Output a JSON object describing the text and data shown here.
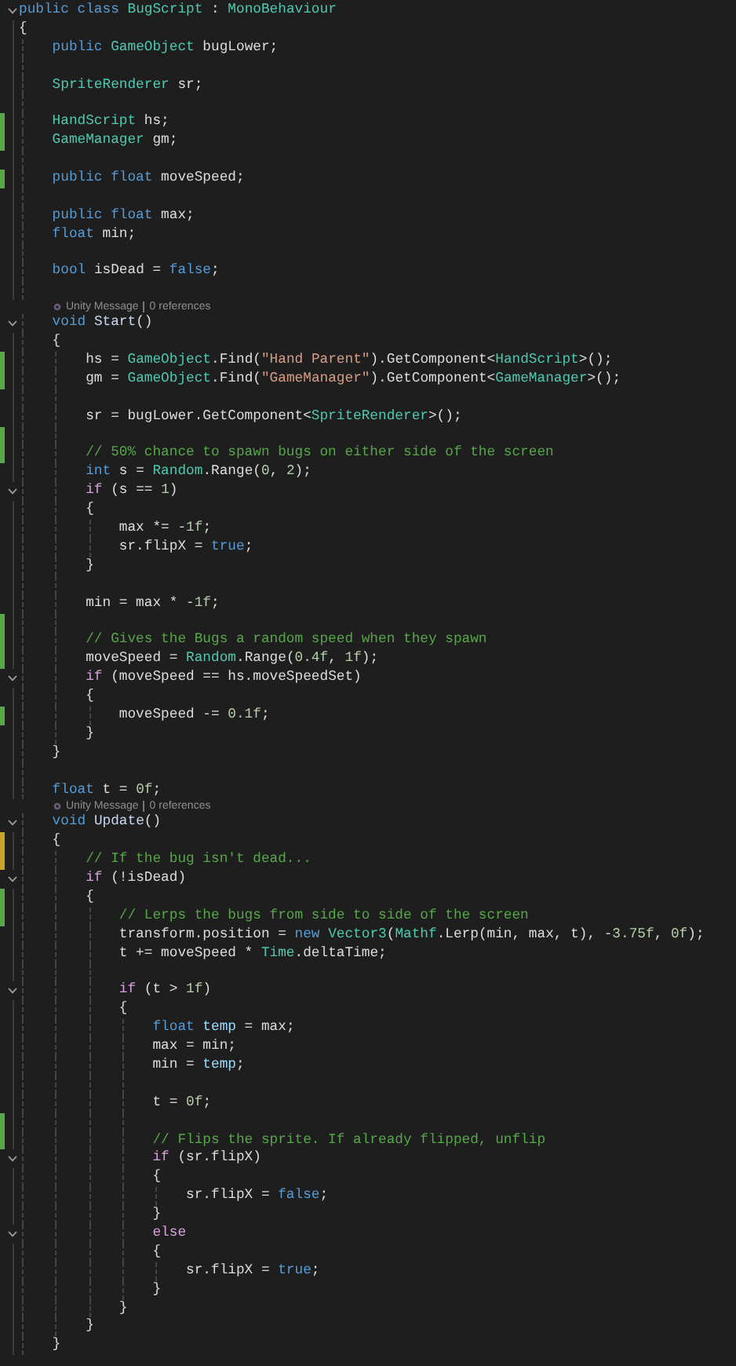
{
  "editor": {
    "lines": [
      {
        "kind": "code",
        "changed": false,
        "foldable": true,
        "tokens": [
          {
            "kind": "kw",
            "text": "public class "
          },
          {
            "kind": "type",
            "text": "BugScript"
          },
          {
            "kind": "plain",
            "text": " : "
          },
          {
            "kind": "type",
            "text": "MonoBehaviour"
          }
        ]
      },
      {
        "kind": "code",
        "changed": false,
        "foldable": false,
        "tokens": [
          {
            "kind": "plain",
            "text": "{"
          }
        ]
      },
      {
        "kind": "code",
        "changed": false,
        "foldable": false,
        "tokens": [
          {
            "kind": "kw",
            "text": "    public "
          },
          {
            "kind": "type",
            "text": "GameObject"
          },
          {
            "kind": "plain",
            "text": " bugLower;"
          }
        ]
      },
      {
        "kind": "blank",
        "changed": false
      },
      {
        "kind": "code",
        "changed": false,
        "foldable": false,
        "tokens": [
          {
            "kind": "type",
            "text": "    SpriteRenderer"
          },
          {
            "kind": "plain",
            "text": " sr;"
          }
        ]
      },
      {
        "kind": "blank",
        "changed": false
      },
      {
        "kind": "code",
        "changed": true,
        "saved": true,
        "foldable": false,
        "tokens": [
          {
            "kind": "type",
            "text": "    HandScript"
          },
          {
            "kind": "plain",
            "text": " hs;"
          }
        ]
      },
      {
        "kind": "code",
        "changed": true,
        "saved": true,
        "foldable": false,
        "tokens": [
          {
            "kind": "type",
            "text": "    GameManager"
          },
          {
            "kind": "plain",
            "text": " gm;"
          }
        ]
      },
      {
        "kind": "blank",
        "changed": false
      },
      {
        "kind": "code",
        "changed": true,
        "saved": true,
        "foldable": false,
        "tokens": [
          {
            "kind": "kw",
            "text": "    public float "
          },
          {
            "kind": "plain",
            "text": "moveSpeed;"
          }
        ]
      },
      {
        "kind": "blank",
        "changed": false
      },
      {
        "kind": "code",
        "changed": false,
        "foldable": false,
        "tokens": [
          {
            "kind": "kw",
            "text": "    public float "
          },
          {
            "kind": "plain",
            "text": "max;"
          }
        ]
      },
      {
        "kind": "code",
        "changed": false,
        "foldable": false,
        "tokens": [
          {
            "kind": "kw",
            "text": "    float "
          },
          {
            "kind": "plain",
            "text": "min;"
          }
        ]
      },
      {
        "kind": "blank",
        "changed": false
      },
      {
        "kind": "code",
        "changed": false,
        "foldable": false,
        "tokens": [
          {
            "kind": "kw",
            "text": "    bool "
          },
          {
            "kind": "plain",
            "text": "isDead = "
          },
          {
            "kind": "kw",
            "text": "false"
          },
          {
            "kind": "plain",
            "text": ";"
          }
        ]
      },
      {
        "kind": "blank",
        "changed": false
      },
      {
        "kind": "codelens",
        "items": [
          "Unity Message",
          "0 references"
        ]
      },
      {
        "kind": "code",
        "changed": false,
        "foldable": true,
        "tokens": [
          {
            "kind": "kw",
            "text": "    void "
          },
          {
            "kind": "fn",
            "text": "Start"
          },
          {
            "kind": "plain",
            "text": "()"
          }
        ]
      },
      {
        "kind": "code",
        "changed": false,
        "foldable": false,
        "tokens": [
          {
            "kind": "plain",
            "text": "    {"
          }
        ]
      },
      {
        "kind": "code",
        "changed": true,
        "saved": true,
        "foldable": false,
        "tokens": [
          {
            "kind": "plain",
            "text": "        hs = "
          },
          {
            "kind": "type",
            "text": "GameObject"
          },
          {
            "kind": "plain",
            "text": ".Find("
          },
          {
            "kind": "str",
            "text": "\"Hand Parent\""
          },
          {
            "kind": "plain",
            "text": ").GetComponent<"
          },
          {
            "kind": "type",
            "text": "HandScript"
          },
          {
            "kind": "plain",
            "text": ">();"
          }
        ]
      },
      {
        "kind": "code",
        "changed": true,
        "saved": true,
        "foldable": false,
        "tokens": [
          {
            "kind": "plain",
            "text": "        gm = "
          },
          {
            "kind": "type",
            "text": "GameObject"
          },
          {
            "kind": "plain",
            "text": ".Find("
          },
          {
            "kind": "str",
            "text": "\"GameManager\""
          },
          {
            "kind": "plain",
            "text": ").GetComponent<"
          },
          {
            "kind": "type",
            "text": "GameManager"
          },
          {
            "kind": "plain",
            "text": ">();"
          }
        ]
      },
      {
        "kind": "blank",
        "changed": false
      },
      {
        "kind": "code",
        "changed": false,
        "foldable": false,
        "tokens": [
          {
            "kind": "plain",
            "text": "        sr = bugLower.GetComponent<"
          },
          {
            "kind": "type",
            "text": "SpriteRenderer"
          },
          {
            "kind": "plain",
            "text": ">();"
          }
        ]
      },
      {
        "kind": "blank",
        "changed": true,
        "saved": true
      },
      {
        "kind": "code",
        "changed": true,
        "saved": true,
        "foldable": false,
        "tokens": [
          {
            "kind": "cmt",
            "text": "        // 50% chance to spawn bugs on either side of the screen"
          }
        ]
      },
      {
        "kind": "code",
        "changed": false,
        "foldable": false,
        "tokens": [
          {
            "kind": "kw",
            "text": "        int "
          },
          {
            "kind": "plain",
            "text": "s = "
          },
          {
            "kind": "type",
            "text": "Random"
          },
          {
            "kind": "plain",
            "text": ".Range("
          },
          {
            "kind": "num",
            "text": "0"
          },
          {
            "kind": "plain",
            "text": ", "
          },
          {
            "kind": "num",
            "text": "2"
          },
          {
            "kind": "plain",
            "text": ");"
          }
        ]
      },
      {
        "kind": "code",
        "changed": false,
        "foldable": true,
        "tokens": [
          {
            "kind": "ctl",
            "text": "        if "
          },
          {
            "kind": "plain",
            "text": "(s == "
          },
          {
            "kind": "num",
            "text": "1"
          },
          {
            "kind": "plain",
            "text": ")"
          }
        ]
      },
      {
        "kind": "code",
        "changed": false,
        "foldable": false,
        "tokens": [
          {
            "kind": "plain",
            "text": "        {"
          }
        ]
      },
      {
        "kind": "code",
        "changed": false,
        "foldable": false,
        "tokens": [
          {
            "kind": "plain",
            "text": "            max *= -"
          },
          {
            "kind": "num",
            "text": "1f"
          },
          {
            "kind": "plain",
            "text": ";"
          }
        ]
      },
      {
        "kind": "code",
        "changed": false,
        "foldable": false,
        "tokens": [
          {
            "kind": "plain",
            "text": "            sr.flipX = "
          },
          {
            "kind": "kw",
            "text": "true"
          },
          {
            "kind": "plain",
            "text": ";"
          }
        ]
      },
      {
        "kind": "code",
        "changed": false,
        "foldable": false,
        "tokens": [
          {
            "kind": "plain",
            "text": "        }"
          }
        ]
      },
      {
        "kind": "blank",
        "changed": false
      },
      {
        "kind": "code",
        "changed": false,
        "foldable": false,
        "tokens": [
          {
            "kind": "plain",
            "text": "        min = max * -"
          },
          {
            "kind": "num",
            "text": "1f"
          },
          {
            "kind": "plain",
            "text": ";"
          }
        ]
      },
      {
        "kind": "blank",
        "changed": true,
        "saved": true
      },
      {
        "kind": "code",
        "changed": true,
        "saved": true,
        "foldable": false,
        "tokens": [
          {
            "kind": "cmt",
            "text": "        // Gives the Bugs a random speed when they spawn"
          }
        ]
      },
      {
        "kind": "code",
        "changed": true,
        "saved": true,
        "foldable": false,
        "tokens": [
          {
            "kind": "plain",
            "text": "        moveSpeed = "
          },
          {
            "kind": "type",
            "text": "Random"
          },
          {
            "kind": "plain",
            "text": ".Range("
          },
          {
            "kind": "num",
            "text": "0.4f"
          },
          {
            "kind": "plain",
            "text": ", "
          },
          {
            "kind": "num",
            "text": "1f"
          },
          {
            "kind": "plain",
            "text": ");"
          }
        ]
      },
      {
        "kind": "code",
        "changed": false,
        "foldable": true,
        "tokens": [
          {
            "kind": "ctl",
            "text": "        if "
          },
          {
            "kind": "plain",
            "text": "(moveSpeed == hs.moveSpeedSet)"
          }
        ]
      },
      {
        "kind": "code",
        "changed": false,
        "foldable": false,
        "tokens": [
          {
            "kind": "plain",
            "text": "        {"
          }
        ]
      },
      {
        "kind": "code",
        "changed": true,
        "saved": true,
        "foldable": false,
        "tokens": [
          {
            "kind": "plain",
            "text": "            moveSpeed -= "
          },
          {
            "kind": "num",
            "text": "0.1f"
          },
          {
            "kind": "plain",
            "text": ";"
          }
        ]
      },
      {
        "kind": "code",
        "changed": false,
        "foldable": false,
        "tokens": [
          {
            "kind": "plain",
            "text": "        }"
          }
        ]
      },
      {
        "kind": "code",
        "changed": false,
        "foldable": false,
        "tokens": [
          {
            "kind": "plain",
            "text": "    }"
          }
        ]
      },
      {
        "kind": "blank",
        "changed": false
      },
      {
        "kind": "code",
        "changed": false,
        "foldable": false,
        "tokens": [
          {
            "kind": "kw",
            "text": "    float "
          },
          {
            "kind": "plain",
            "text": "t = "
          },
          {
            "kind": "num",
            "text": "0f"
          },
          {
            "kind": "plain",
            "text": ";"
          }
        ]
      },
      {
        "kind": "codelens",
        "items": [
          "Unity Message",
          "0 references"
        ]
      },
      {
        "kind": "code",
        "changed": false,
        "foldable": true,
        "tokens": [
          {
            "kind": "kw",
            "text": "    void "
          },
          {
            "kind": "fn",
            "text": "Update"
          },
          {
            "kind": "plain",
            "text": "()"
          }
        ]
      },
      {
        "kind": "code",
        "changed": true,
        "saved": false,
        "foldable": false,
        "tokens": [
          {
            "kind": "plain",
            "text": "    {"
          }
        ]
      },
      {
        "kind": "code",
        "changed": true,
        "saved": false,
        "foldable": false,
        "tokens": [
          {
            "kind": "cmt",
            "text": "        // If the bug isn't dead..."
          }
        ]
      },
      {
        "kind": "code",
        "changed": false,
        "foldable": true,
        "tokens": [
          {
            "kind": "ctl",
            "text": "        if "
          },
          {
            "kind": "plain",
            "text": "(!isDead)"
          }
        ]
      },
      {
        "kind": "code",
        "changed": true,
        "saved": true,
        "foldable": false,
        "tokens": [
          {
            "kind": "plain",
            "text": "        {"
          }
        ]
      },
      {
        "kind": "code",
        "changed": true,
        "saved": true,
        "foldable": false,
        "tokens": [
          {
            "kind": "cmt",
            "text": "            // Lerps the bugs from side to side of the screen"
          }
        ]
      },
      {
        "kind": "code",
        "changed": false,
        "foldable": false,
        "tokens": [
          {
            "kind": "plain",
            "text": "            transform.position = "
          },
          {
            "kind": "kw",
            "text": "new "
          },
          {
            "kind": "type",
            "text": "Vector3"
          },
          {
            "kind": "plain",
            "text": "("
          },
          {
            "kind": "type",
            "text": "Mathf"
          },
          {
            "kind": "plain",
            "text": ".Lerp(min, max, t), -"
          },
          {
            "kind": "num",
            "text": "3.75f"
          },
          {
            "kind": "plain",
            "text": ", "
          },
          {
            "kind": "num",
            "text": "0f"
          },
          {
            "kind": "plain",
            "text": ");"
          }
        ]
      },
      {
        "kind": "code",
        "changed": false,
        "foldable": false,
        "tokens": [
          {
            "kind": "plain",
            "text": "            t += moveSpeed * "
          },
          {
            "kind": "type",
            "text": "Time"
          },
          {
            "kind": "plain",
            "text": ".deltaTime;"
          }
        ]
      },
      {
        "kind": "blank",
        "changed": false
      },
      {
        "kind": "code",
        "changed": false,
        "foldable": true,
        "tokens": [
          {
            "kind": "ctl",
            "text": "            if "
          },
          {
            "kind": "plain",
            "text": "(t > "
          },
          {
            "kind": "num",
            "text": "1f"
          },
          {
            "kind": "plain",
            "text": ")"
          }
        ]
      },
      {
        "kind": "code",
        "changed": false,
        "foldable": false,
        "tokens": [
          {
            "kind": "plain",
            "text": "            {"
          }
        ]
      },
      {
        "kind": "code",
        "changed": false,
        "foldable": false,
        "tokens": [
          {
            "kind": "kw",
            "text": "                float "
          },
          {
            "kind": "local",
            "text": "temp"
          },
          {
            "kind": "plain",
            "text": " = max;"
          }
        ]
      },
      {
        "kind": "code",
        "changed": false,
        "foldable": false,
        "tokens": [
          {
            "kind": "plain",
            "text": "                max = min;"
          }
        ]
      },
      {
        "kind": "code",
        "changed": false,
        "foldable": false,
        "tokens": [
          {
            "kind": "plain",
            "text": "                min = "
          },
          {
            "kind": "local",
            "text": "temp"
          },
          {
            "kind": "plain",
            "text": ";"
          }
        ]
      },
      {
        "kind": "blank",
        "changed": false
      },
      {
        "kind": "code",
        "changed": false,
        "foldable": false,
        "tokens": [
          {
            "kind": "plain",
            "text": "                t = "
          },
          {
            "kind": "num",
            "text": "0f"
          },
          {
            "kind": "plain",
            "text": ";"
          }
        ]
      },
      {
        "kind": "blank",
        "changed": true,
        "saved": true
      },
      {
        "kind": "code",
        "changed": true,
        "saved": true,
        "foldable": false,
        "tokens": [
          {
            "kind": "cmt",
            "text": "                // Flips the sprite. If already flipped, unflip"
          }
        ]
      },
      {
        "kind": "code",
        "changed": false,
        "foldable": true,
        "tokens": [
          {
            "kind": "ctl",
            "text": "                if "
          },
          {
            "kind": "plain",
            "text": "(sr.flipX)"
          }
        ]
      },
      {
        "kind": "code",
        "changed": false,
        "foldable": false,
        "tokens": [
          {
            "kind": "plain",
            "text": "                {"
          }
        ]
      },
      {
        "kind": "code",
        "changed": false,
        "foldable": false,
        "tokens": [
          {
            "kind": "plain",
            "text": "                    sr.flipX = "
          },
          {
            "kind": "kw",
            "text": "false"
          },
          {
            "kind": "plain",
            "text": ";"
          }
        ]
      },
      {
        "kind": "code",
        "changed": false,
        "foldable": false,
        "tokens": [
          {
            "kind": "plain",
            "text": "                }"
          }
        ]
      },
      {
        "kind": "code",
        "changed": false,
        "foldable": true,
        "tokens": [
          {
            "kind": "ctl",
            "text": "                else"
          }
        ]
      },
      {
        "kind": "code",
        "changed": false,
        "foldable": false,
        "tokens": [
          {
            "kind": "plain",
            "text": "                {"
          }
        ]
      },
      {
        "kind": "code",
        "changed": false,
        "foldable": false,
        "tokens": [
          {
            "kind": "plain",
            "text": "                    sr.flipX = "
          },
          {
            "kind": "kw",
            "text": "true"
          },
          {
            "kind": "plain",
            "text": ";"
          }
        ]
      },
      {
        "kind": "code",
        "changed": false,
        "foldable": false,
        "tokens": [
          {
            "kind": "plain",
            "text": "                }"
          }
        ]
      },
      {
        "kind": "code",
        "changed": false,
        "foldable": false,
        "tokens": [
          {
            "kind": "plain",
            "text": "            }"
          }
        ]
      },
      {
        "kind": "code",
        "changed": false,
        "foldable": false,
        "tokens": [
          {
            "kind": "plain",
            "text": "        }"
          }
        ]
      },
      {
        "kind": "code",
        "changed": false,
        "foldable": false,
        "tokens": [
          {
            "kind": "plain",
            "text": "    }"
          }
        ]
      }
    ]
  }
}
